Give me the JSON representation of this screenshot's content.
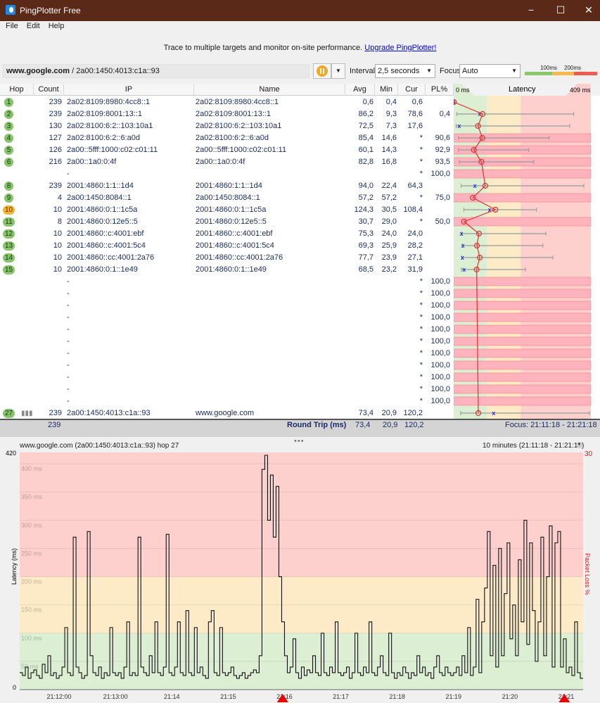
{
  "window": {
    "title": "PingPlotter Free",
    "minimize": "−",
    "maximize": "☐",
    "close": "✕"
  },
  "menu": [
    "File",
    "Edit",
    "Help"
  ],
  "banner": {
    "text": "Trace to multiple targets and monitor on-site performance.",
    "link": "Upgrade PingPlotter!"
  },
  "toolbar": {
    "target_host": "www.google.com",
    "target_ip": " / 2a00:1450:4013:c1a::93",
    "interval_label": "Interval",
    "interval_value": "2,5 seconds",
    "focus_label": "Focus",
    "focus_value": "Auto",
    "scale_100": "100ms",
    "scale_200": "200ms",
    "pause_icon": "pause-icon"
  },
  "columns": [
    "Hop",
    "Count",
    "IP",
    "Name",
    "Avg",
    "Min",
    "Cur",
    "PL%",
    "Latency"
  ],
  "latency_scale": {
    "min_label": "0 ms",
    "max_label": "409 ms",
    "max": 409,
    "green_max": 100,
    "yellow_max": 200
  },
  "colors": {
    "green": "#dcefd3",
    "yellow": "#fdebc8",
    "red": "#fdd0cd",
    "loss": "#ffb3bd",
    "line": "#e03030",
    "cur": "#2233cc",
    "badge": "#86c36a",
    "badge_warn": "#f5b335"
  },
  "hops": [
    {
      "hop": "1",
      "count": "239",
      "ip": "2a02:8109:8980:4cc8::1",
      "name": "2a02:8109:8980:4cc8::1",
      "avg": "0,6",
      "min": "0,4",
      "cur": "0,6",
      "pl": "",
      "max": 2
    },
    {
      "hop": "2",
      "count": "239",
      "ip": "2a02:8109:8001:13::1",
      "name": "2a02:8109:8001:13::1",
      "avg": "86,2",
      "min": "9,3",
      "cur": "78,6",
      "pl": "0,4",
      "max": 358
    },
    {
      "hop": "3",
      "count": "130",
      "ip": "2a02:8100:6:2::103:10a1",
      "name": "2a02:8100:6:2::103:10a1",
      "avg": "72,5",
      "min": "7,3",
      "cur": "17,6",
      "pl": "",
      "max": 346
    },
    {
      "hop": "4",
      "count": "127",
      "ip": "2a02:8100:6:2::6:a0d",
      "name": "2a02:8100:6:2::6:a0d",
      "avg": "85,4",
      "min": "14,6",
      "cur": "*",
      "pl": "90,6",
      "max": 285
    },
    {
      "hop": "5",
      "count": "126",
      "ip": "2a00::5fff:1000:c02:c01:11",
      "name": "2a00::5fff:1000:c02:c01:11",
      "avg": "60,1",
      "min": "14,3",
      "cur": "*",
      "pl": "92,9",
      "max": 224
    },
    {
      "hop": "6",
      "count": "216",
      "ip": "2a00::1a0:0:4f",
      "name": "2a00::1a0:0:4f",
      "avg": "82,8",
      "min": "16,8",
      "cur": "*",
      "pl": "93,5",
      "max": 239
    },
    {
      "hop": "",
      "count": "",
      "ip": "-",
      "name": "",
      "avg": "",
      "min": "",
      "cur": "*",
      "pl": "100,0"
    },
    {
      "hop": "8",
      "count": "239",
      "ip": "2001:4860:1:1::1d4",
      "name": "2001:4860:1:1::1d4",
      "avg": "94,0",
      "min": "22,4",
      "cur": "64,3",
      "pl": "",
      "max": 388
    },
    {
      "hop": "9",
      "count": "4",
      "ip": "2a00:1450:8084::1",
      "name": "2a00:1450:8084::1",
      "avg": "57,2",
      "min": "57,2",
      "cur": "*",
      "pl": "75,0"
    },
    {
      "hop": "10",
      "count": "10",
      "ip": "2001:4860:0:1::1c5a",
      "name": "2001:4860:0:1::1c5a",
      "avg": "124,3",
      "min": "30,5",
      "cur": "108,4",
      "pl": "",
      "max": 247,
      "warn": true
    },
    {
      "hop": "11",
      "count": "8",
      "ip": "2001:4860:0:12e5::5",
      "name": "2001:4860:0:12e5::5",
      "avg": "30,7",
      "min": "29,0",
      "cur": "*",
      "pl": "50,0"
    },
    {
      "hop": "12",
      "count": "10",
      "ip": "2001:4860::c:4001:ebf",
      "name": "2001:4860::c:4001:ebf",
      "avg": "75,3",
      "min": "24,0",
      "cur": "24,0",
      "pl": "",
      "max": 275
    },
    {
      "hop": "13",
      "count": "10",
      "ip": "2001:4860::c:4001:5c4",
      "name": "2001:4860::c:4001:5c4",
      "avg": "69,3",
      "min": "25,9",
      "cur": "28,2",
      "pl": "",
      "max": 266
    },
    {
      "hop": "14",
      "count": "10",
      "ip": "2001:4860::cc:4001:2a76",
      "name": "2001:4860::cc:4001:2a76",
      "avg": "77,7",
      "min": "23,9",
      "cur": "27,1",
      "pl": "",
      "max": 296
    },
    {
      "hop": "15",
      "count": "10",
      "ip": "2001:4860:0:1::1e49",
      "name": "2001:4860:0:1::1e49",
      "avg": "68,5",
      "min": "23,2",
      "cur": "31,9",
      "pl": "",
      "max": 214
    },
    {
      "hop": "",
      "count": "",
      "ip": "-",
      "name": "",
      "avg": "",
      "min": "",
      "cur": "*",
      "pl": "100,0"
    },
    {
      "hop": "",
      "count": "",
      "ip": "-",
      "name": "",
      "avg": "",
      "min": "",
      "cur": "*",
      "pl": "100,0"
    },
    {
      "hop": "",
      "count": "",
      "ip": "-",
      "name": "",
      "avg": "",
      "min": "",
      "cur": "*",
      "pl": "100,0"
    },
    {
      "hop": "",
      "count": "",
      "ip": "-",
      "name": "",
      "avg": "",
      "min": "",
      "cur": "*",
      "pl": "100,0"
    },
    {
      "hop": "",
      "count": "",
      "ip": "-",
      "name": "",
      "avg": "",
      "min": "",
      "cur": "*",
      "pl": "100,0"
    },
    {
      "hop": "",
      "count": "",
      "ip": "-",
      "name": "",
      "avg": "",
      "min": "",
      "cur": "*",
      "pl": "100,0"
    },
    {
      "hop": "",
      "count": "",
      "ip": "-",
      "name": "",
      "avg": "",
      "min": "",
      "cur": "*",
      "pl": "100,0"
    },
    {
      "hop": "",
      "count": "",
      "ip": "-",
      "name": "",
      "avg": "",
      "min": "",
      "cur": "*",
      "pl": "100,0"
    },
    {
      "hop": "",
      "count": "",
      "ip": "-",
      "name": "",
      "avg": "",
      "min": "",
      "cur": "*",
      "pl": "100,0"
    },
    {
      "hop": "",
      "count": "",
      "ip": "-",
      "name": "",
      "avg": "",
      "min": "",
      "cur": "*",
      "pl": "100,0"
    },
    {
      "hop": "",
      "count": "",
      "ip": "-",
      "name": "",
      "avg": "",
      "min": "",
      "cur": "*",
      "pl": "100,0"
    },
    {
      "hop": "27",
      "count": "239",
      "ip": "2a00:1450:4013:c1a::93",
      "name": "www.google.com",
      "avg": "73,4",
      "min": "20,9",
      "cur": "120,2",
      "pl": "",
      "max": 405,
      "graph_icon": "bar-chart-icon"
    }
  ],
  "summary": {
    "count": "239",
    "label": "Round Trip (ms)",
    "avg": "73,4",
    "min": "20,9",
    "cur": "120,2",
    "focus": "Focus: 21:11:18 - 21:21:18"
  },
  "chart_data": {
    "type": "line",
    "title": "www.google.com (2a00:1450:4013:c1a::93) hop 27",
    "range_label": "10 minutes (21:11:18 - 21:21:18)",
    "ylabel": "Latency (ms)",
    "y2label": "Packet Loss %",
    "ylim": [
      0,
      420
    ],
    "y2max": "30",
    "ytick_labels": [
      "420",
      "400 ms",
      "350 ms",
      "300 ms",
      "250 ms",
      "200 ms",
      "150 ms",
      "100 ms",
      "50 ms",
      "0"
    ],
    "yticks": [
      400,
      350,
      300,
      250,
      200,
      150,
      100,
      50
    ],
    "xstart": "21:11:18",
    "xend": "21:21:18",
    "xticks": [
      {
        "t": "21:12:00",
        "s": 42
      },
      {
        "t": "21:13:00",
        "s": 102
      },
      {
        "t": "21:14",
        "s": 162
      },
      {
        "t": "21:15",
        "s": 222
      },
      {
        "t": "21:16",
        "s": 282
      },
      {
        "t": "21:17",
        "s": 342
      },
      {
        "t": "21:18",
        "s": 402
      },
      {
        "t": "21:19",
        "s": 462
      },
      {
        "t": "21:20",
        "s": 522
      },
      {
        "t": "21:21",
        "s": 582
      }
    ],
    "sample_seconds": 3,
    "loss_markers_seconds": [
      280,
      580
    ],
    "values": [
      30,
      25,
      40,
      20,
      30,
      35,
      25,
      20,
      45,
      30,
      60,
      25,
      30,
      20,
      25,
      40,
      110,
      30,
      25,
      270,
      40,
      30,
      20,
      25,
      280,
      60,
      30,
      25,
      40,
      20,
      30,
      25,
      110,
      30,
      25,
      30,
      20,
      40,
      120,
      25,
      30,
      25,
      270,
      40,
      30,
      25,
      60,
      30,
      120,
      30,
      25,
      40,
      275,
      30,
      25,
      40,
      120,
      30,
      25,
      140,
      30,
      25,
      110,
      30,
      40,
      25,
      20,
      120,
      140,
      30,
      25,
      110,
      30,
      25,
      30,
      40,
      25,
      20,
      25,
      30,
      20,
      25,
      30,
      35,
      30,
      60,
      390,
      415,
      300,
      380,
      270,
      360,
      200,
      120,
      60,
      30,
      40,
      90,
      30,
      20,
      40,
      25,
      35,
      30,
      60,
      30,
      25,
      100,
      30,
      25,
      40,
      30,
      120,
      30,
      25,
      30,
      40,
      20,
      30,
      100,
      30,
      25,
      40,
      30,
      120,
      30,
      25,
      40,
      60,
      30,
      25,
      100,
      30,
      20,
      30,
      25,
      40,
      30,
      20,
      30,
      25,
      60,
      30,
      40,
      25,
      30,
      20,
      40,
      60,
      30,
      25,
      40,
      30,
      25,
      30,
      40,
      25,
      60,
      30,
      110,
      25,
      40,
      160,
      30,
      120,
      180,
      280,
      60,
      220,
      40,
      250,
      60,
      170,
      260,
      90,
      150,
      60,
      230,
      120,
      300,
      80,
      260,
      140,
      50,
      120,
      270,
      60,
      200,
      290,
      40,
      260,
      280,
      40,
      90,
      30,
      40,
      25,
      120,
      30,
      20
    ]
  }
}
